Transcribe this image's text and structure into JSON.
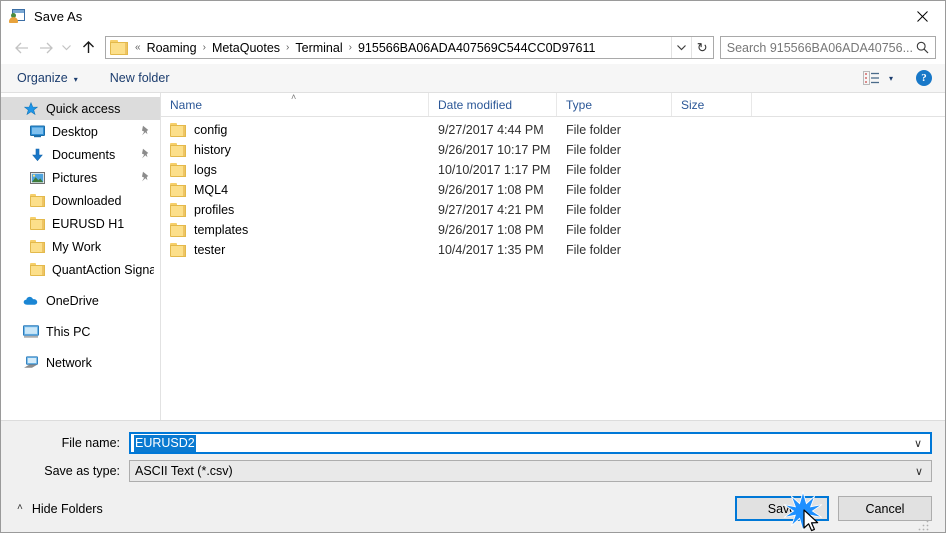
{
  "window": {
    "title": "Save As",
    "icon": "save-as-app-icon",
    "close_label": "✕"
  },
  "nav": {
    "back_icon": "arrow-left-icon",
    "forward_icon": "arrow-right-icon",
    "recent_icon": "chevron-down-icon",
    "up_icon": "arrow-up-icon",
    "breadcrumb": {
      "folder_icon": "folder-icon",
      "leading": "«",
      "items": [
        "Roaming",
        "MetaQuotes",
        "Terminal",
        "915566BA06ADA407569C544CC0D97611"
      ],
      "separator": "›",
      "dropdown_icon": "chevron-down-icon",
      "refresh_icon": "refresh-icon",
      "refresh_glyph": "↻"
    },
    "search": {
      "placeholder": "Search 915566BA06ADA40756...",
      "icon": "search-icon"
    }
  },
  "toolbar": {
    "organize_label": "Organize",
    "organize_caret": "▾",
    "new_folder_label": "New folder",
    "view_icon": "list-view-icon",
    "view_caret": "▾",
    "help_icon": "help-icon",
    "help_label": "?"
  },
  "sidebar": {
    "groups": [
      {
        "header": {
          "label": "Quick access",
          "icon": "star-icon",
          "selected": true
        },
        "items": [
          {
            "label": "Desktop",
            "icon": "desktop-icon",
            "pinned": true
          },
          {
            "label": "Documents",
            "icon": "documents-download-icon",
            "pinned": true
          },
          {
            "label": "Pictures",
            "icon": "pictures-icon",
            "pinned": true
          },
          {
            "label": "Downloaded",
            "icon": "folder-icon",
            "pinned": false
          },
          {
            "label": "EURUSD H1",
            "icon": "folder-icon",
            "pinned": false
          },
          {
            "label": "My Work",
            "icon": "folder-icon",
            "pinned": false
          },
          {
            "label": "QuantAction Signal",
            "icon": "folder-icon",
            "pinned": false
          }
        ]
      },
      {
        "header": {
          "label": "OneDrive",
          "icon": "onedrive-cloud-icon",
          "selected": false
        },
        "items": []
      },
      {
        "header": {
          "label": "This PC",
          "icon": "this-pc-icon",
          "selected": false
        },
        "items": []
      },
      {
        "header": {
          "label": "Network",
          "icon": "network-icon",
          "selected": false
        },
        "items": []
      }
    ]
  },
  "filelist": {
    "columns": [
      "Name",
      "Date modified",
      "Type",
      "Size"
    ],
    "sort_indicator": "˄",
    "rows": [
      {
        "name": "config",
        "date": "9/27/2017 4:44 PM",
        "type": "File folder",
        "size": "",
        "icon": "folder-icon"
      },
      {
        "name": "history",
        "date": "9/26/2017 10:17 PM",
        "type": "File folder",
        "size": "",
        "icon": "folder-icon"
      },
      {
        "name": "logs",
        "date": "10/10/2017 1:17 PM",
        "type": "File folder",
        "size": "",
        "icon": "folder-icon"
      },
      {
        "name": "MQL4",
        "date": "9/26/2017 1:08 PM",
        "type": "File folder",
        "size": "",
        "icon": "folder-icon"
      },
      {
        "name": "profiles",
        "date": "9/27/2017 4:21 PM",
        "type": "File folder",
        "size": "",
        "icon": "folder-icon"
      },
      {
        "name": "templates",
        "date": "9/26/2017 1:08 PM",
        "type": "File folder",
        "size": "",
        "icon": "folder-icon"
      },
      {
        "name": "tester",
        "date": "10/4/2017 1:35 PM",
        "type": "File folder",
        "size": "",
        "icon": "folder-icon"
      }
    ]
  },
  "footer": {
    "filename_label": "File name:",
    "filename_value": "EURUSD2",
    "filename_chevron": "∨",
    "filetype_label": "Save as type:",
    "filetype_value": "ASCII Text (*.csv)",
    "filetype_chevron": "∨",
    "hide_folders_label": "Hide Folders",
    "hide_folders_caret": "˄",
    "save_label": "Save",
    "cancel_label": "Cancel"
  },
  "colors": {
    "accent": "#0078d7",
    "selection": "#0a7ad1",
    "column_header_text": "#2b5797",
    "command_text": "#1c3d6e",
    "folder": "#fcdf8a",
    "sparkle": "#1e90ff"
  }
}
